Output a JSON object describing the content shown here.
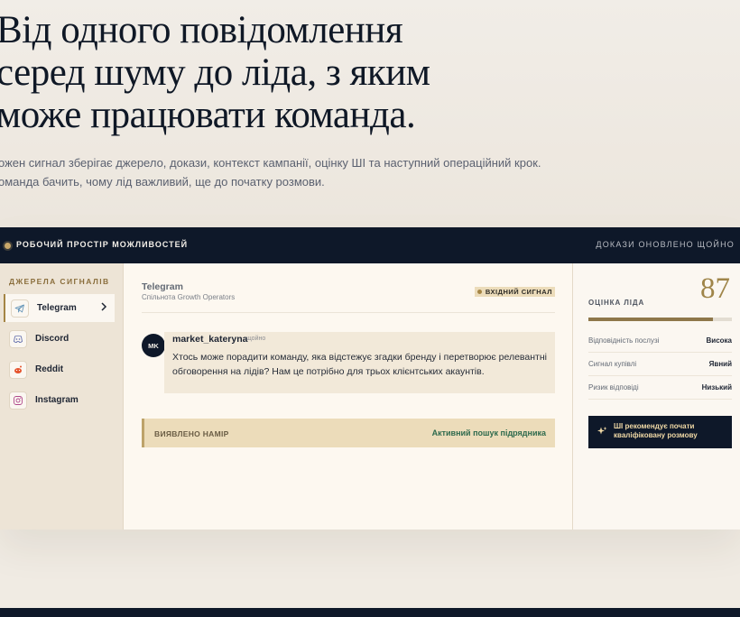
{
  "hero": {
    "headline_lines": [
      "Від одного повідомлення",
      "серед шуму до ліда, з яким",
      "може працювати команда."
    ],
    "sub_lines": [
      "ожен сигнал зберігає джерело, докази, контекст кампанії, оцінку ШІ та наступний операційний крок.",
      "оманда бачить, чому лід важливий, ще до початку розмови."
    ]
  },
  "workspace": {
    "title": "РОБОЧИЙ ПРОСТІР МОЖЛИВОСТЕЙ",
    "status": "ДОКАЗИ ОНОВЛЕНО ЩОЙНО"
  },
  "sidebar": {
    "title": "ДЖЕРЕЛА СИГНАЛІВ",
    "items": [
      {
        "label": "Telegram",
        "icon": "telegram-icon",
        "active": true
      },
      {
        "label": "Discord",
        "icon": "discord-icon",
        "active": false
      },
      {
        "label": "Reddit",
        "icon": "reddit-icon",
        "active": false
      },
      {
        "label": "Instagram",
        "icon": "instagram-icon",
        "active": false
      }
    ]
  },
  "feed": {
    "channel": "Telegram",
    "channel_sub": "Спільнота Growth Operators",
    "badge": "ВХІДНИЙ СИГНАЛ",
    "message": {
      "avatar": "MK",
      "author": "market_kateryna",
      "time": "щойно",
      "text": "Хтось може порадити команду, яка відстежує згадки бренду і перетворює релевантні обговорення на лідів? Нам це потрібно для трьох клієнтських акаунтів."
    },
    "intent": {
      "label": "ВИЯВЛЕНО НАМІР",
      "value": "Активний пошук підрядника"
    }
  },
  "panel": {
    "score_label": "ОЦІНКА ЛІДА",
    "score": "87",
    "score_fraction": 0.87,
    "rows": [
      {
        "k": "Відповідність послузі",
        "v": "Висока"
      },
      {
        "k": "Сигнал купівлі",
        "v": "Явний"
      },
      {
        "k": "Ризик відповіді",
        "v": "Низький"
      }
    ],
    "ai_button": "ШІ рекомендує почати кваліфіковану розмову"
  },
  "colors": {
    "navy": "#0e1829",
    "gold": "#a58545",
    "sand": "#ecdcba",
    "green": "#2e6a4d"
  }
}
